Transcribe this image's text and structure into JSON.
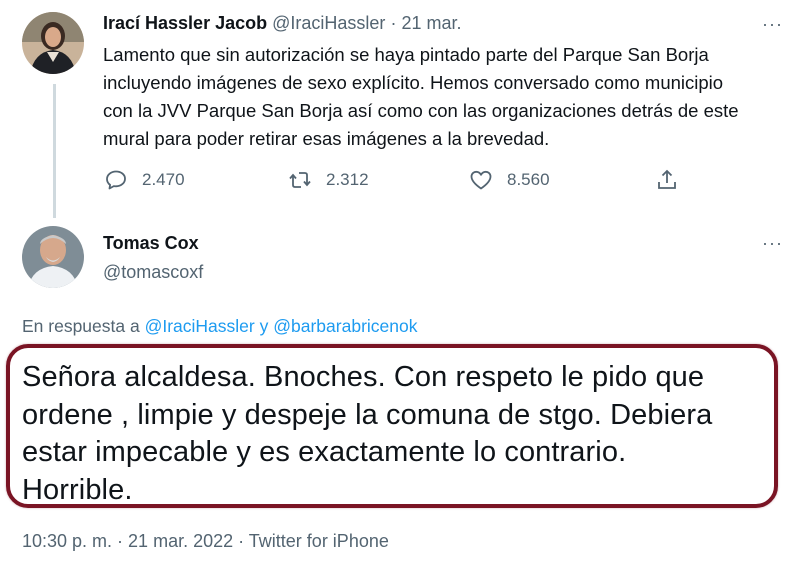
{
  "tweet1": {
    "display_name": "Irací Hassler Jacob",
    "handle": "@IraciHassler",
    "separator": "·",
    "date": "21 mar.",
    "more": "···",
    "text_lines": [
      "Lamento que sin autorización se haya pintado parte del Parque San Borja",
      "incluyendo imágenes de sexo explícito. Hemos conversado como municipio",
      "con la JVV Parque San Borja así como con las organizaciones detrás de este",
      "mural para poder retirar esas imágenes a la brevedad."
    ],
    "actions": {
      "replies": "2.470",
      "retweets": "2.312",
      "likes": "8.560"
    }
  },
  "tweet2": {
    "display_name": "Tomas Cox",
    "handle": "@tomascoxf",
    "more": "···",
    "reply_prefix": "En respuesta a",
    "reply_to_1": "@IraciHassler",
    "reply_join": "y",
    "reply_to_2": "@barbarabricenok",
    "text_lines": [
      "Señora alcaldesa.  Bnoches.  Con respeto le pido que",
      "ordene , limpie y despeje la comuna de stgo. Debiera",
      "estar impecable  y es exactamente lo contrario.",
      "Horrible."
    ],
    "footer": "10:30 p. m. · 21 mar. 2022 · Twitter for iPhone"
  },
  "colors": {
    "text": "#0f1419",
    "muted": "#536471",
    "link": "#1d9bf0",
    "highlight_border": "#7a1424",
    "thread_line": "#cfd9de"
  }
}
